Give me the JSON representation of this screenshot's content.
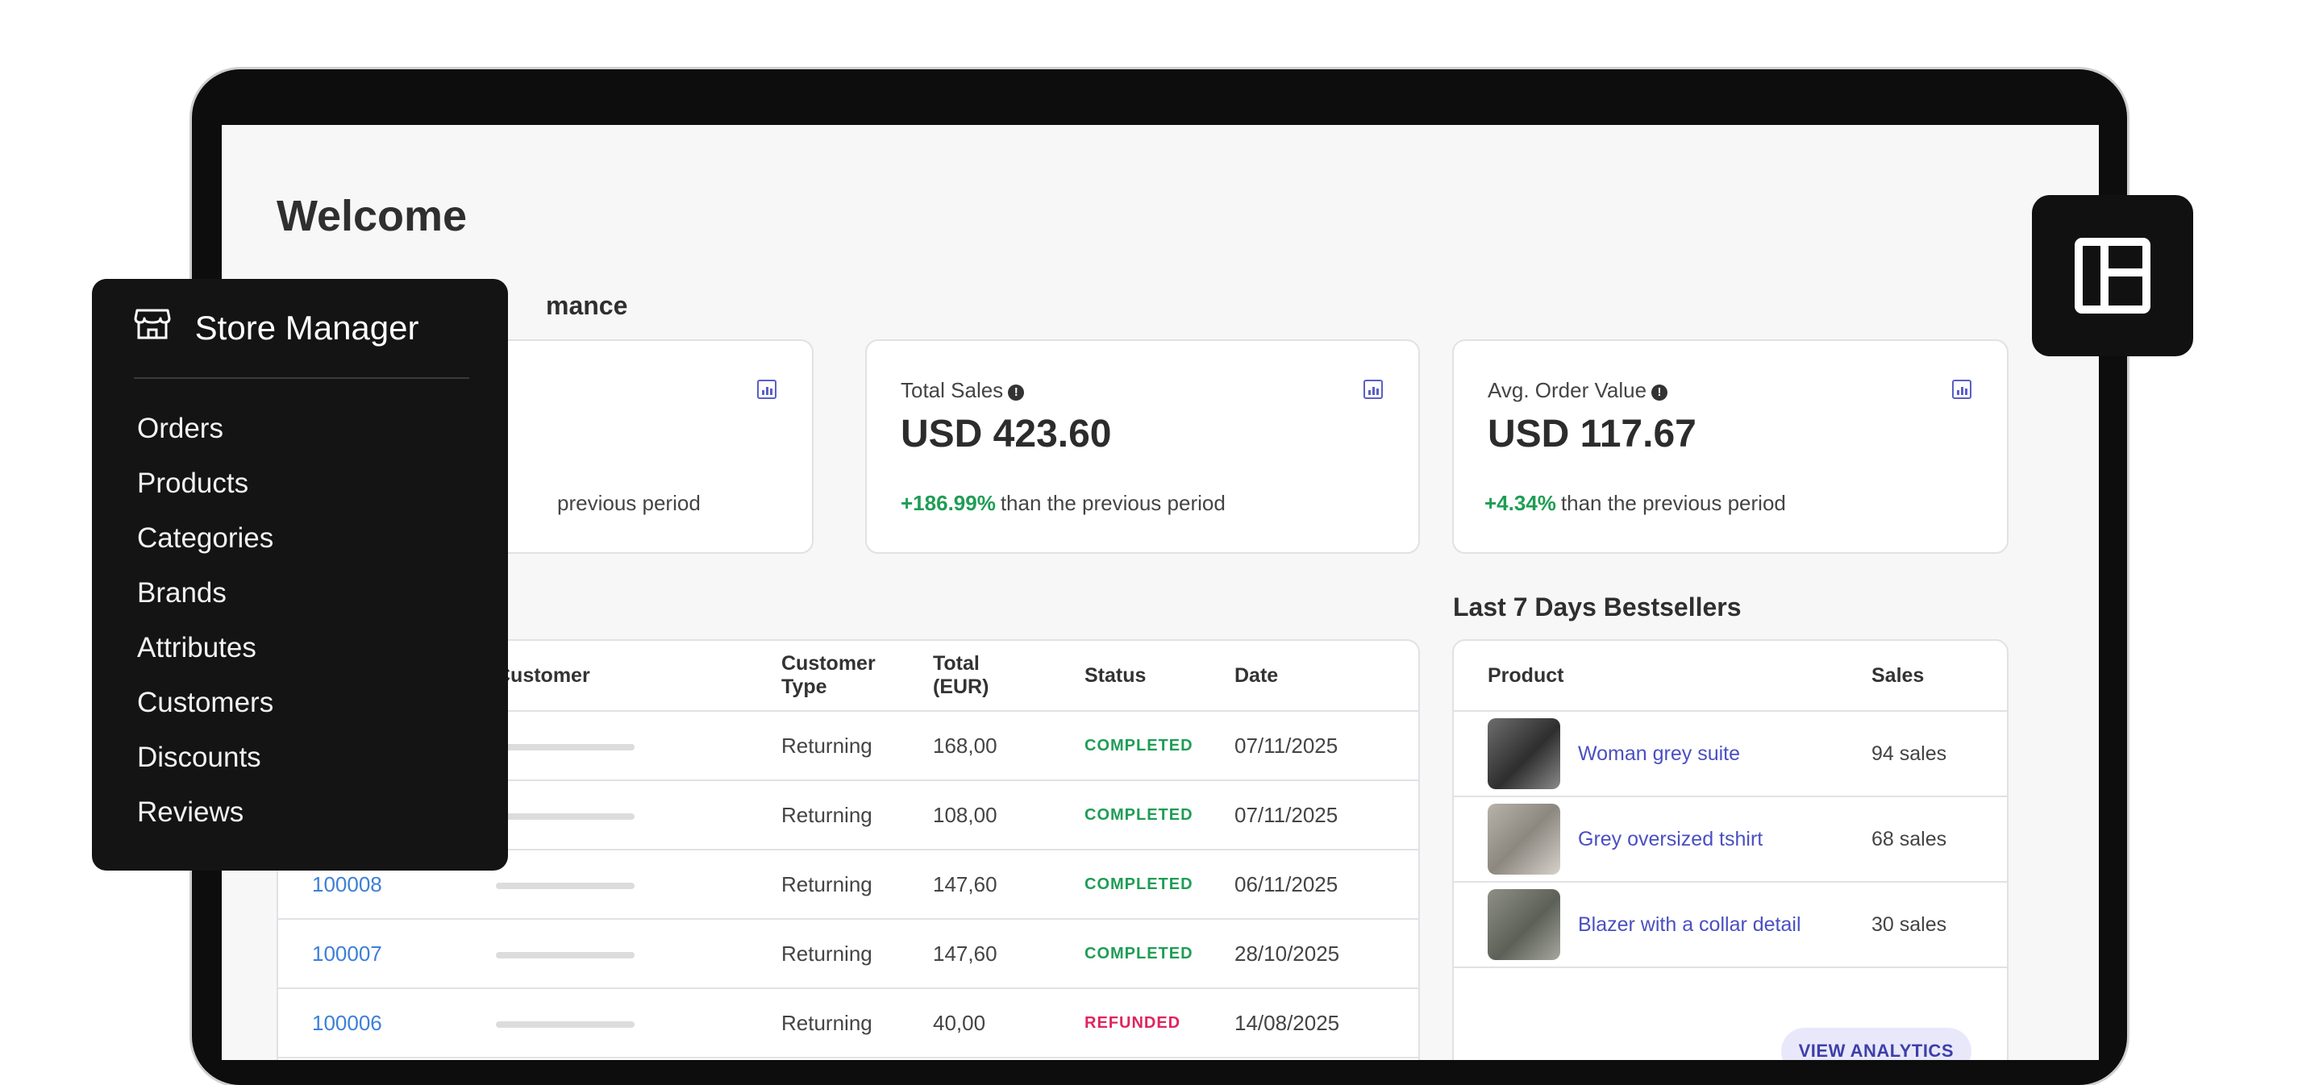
{
  "page": {
    "title": "Welcome"
  },
  "performance": {
    "title_visible": "mance"
  },
  "metrics": [
    {
      "label": "",
      "value": "",
      "delta_pct": "",
      "delta_text": "previous period"
    },
    {
      "label": "Total Sales",
      "value": "USD 423.60",
      "delta_pct": "+186.99%",
      "delta_text": "than the previous period"
    },
    {
      "label": "Avg. Order Value",
      "value": "USD 117.67",
      "delta_pct": "+4.34%",
      "delta_text": "than the previous period"
    }
  ],
  "orders": {
    "columns": [
      "Customer",
      "Customer Type",
      "Total (EUR)",
      "Status",
      "Date"
    ],
    "rows": [
      {
        "id": "",
        "type": "Returning",
        "total": "168,00",
        "status": "COMPLETED",
        "date": "07/11/2025"
      },
      {
        "id": "",
        "type": "Returning",
        "total": "108,00",
        "status": "COMPLETED",
        "date": "07/11/2025"
      },
      {
        "id": "100008",
        "type": "Returning",
        "total": "147,60",
        "status": "COMPLETED",
        "date": "06/11/2025"
      },
      {
        "id": "100007",
        "type": "Returning",
        "total": "147,60",
        "status": "COMPLETED",
        "date": "28/10/2025"
      },
      {
        "id": "100006",
        "type": "Returning",
        "total": "40,00",
        "status": "REFUNDED",
        "date": "14/08/2025"
      }
    ]
  },
  "bestsellers": {
    "title": "Last 7 Days Bestsellers",
    "columns": [
      "Product",
      "Sales"
    ],
    "rows": [
      {
        "name": "Woman grey suite",
        "sales": "94 sales"
      },
      {
        "name": "Grey oversized tshirt",
        "sales": "68 sales"
      },
      {
        "name": "Blazer with a collar detail",
        "sales": "30 sales"
      }
    ],
    "button": "VIEW ANALYTICS"
  },
  "sidebar": {
    "brand": "Store Manager",
    "items": [
      "Orders",
      "Products",
      "Categories",
      "Brands",
      "Attributes",
      "Customers",
      "Discounts",
      "Reviews"
    ]
  },
  "colors": {
    "accent": "#4a4fc2",
    "positive": "#1f9d55",
    "negative": "#e0245e",
    "link": "#3d7fd9",
    "sidebar_bg": "#141414"
  },
  "icons": {
    "brand": "store-icon",
    "metric": "bar-chart-icon",
    "info": "info-icon",
    "layout": "layout-icon"
  }
}
